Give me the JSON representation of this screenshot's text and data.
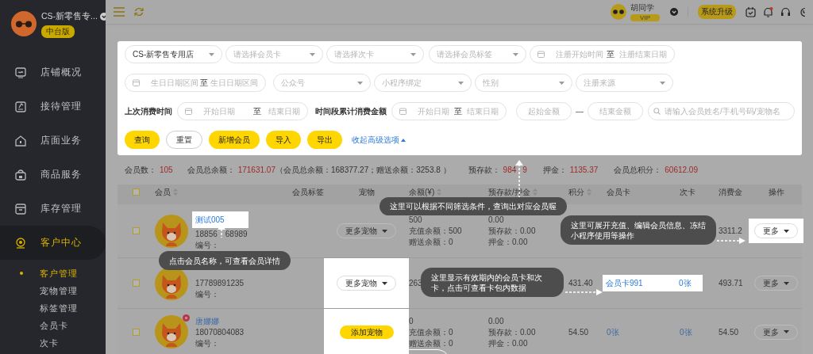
{
  "sidebar": {
    "store_name": "CS-新零售专...",
    "edition": "中台版",
    "menu": [
      {
        "label": "店铺概况",
        "selected": false
      },
      {
        "label": "接待管理",
        "selected": false
      },
      {
        "label": "店面业务",
        "selected": false
      },
      {
        "label": "商品服务",
        "selected": false
      },
      {
        "label": "库存管理",
        "selected": false
      },
      {
        "label": "客户中心",
        "selected": true
      }
    ],
    "submenu": [
      {
        "label": "客户管理",
        "selected": true
      },
      {
        "label": "宠物管理",
        "selected": false
      },
      {
        "label": "标签管理",
        "selected": false
      },
      {
        "label": "会员卡",
        "selected": false
      },
      {
        "label": "次卡",
        "selected": false
      }
    ]
  },
  "top_bar": {
    "user_name": "胡同学",
    "user_badge": "VIP",
    "upgrade_button": "系统升级",
    "unread_notifications": true
  },
  "filters": {
    "rows": [
      [
        {
          "kind": "select",
          "value": "CS-新零售专用店"
        },
        {
          "kind": "select",
          "placeholder": "请选择会员卡"
        },
        {
          "kind": "select",
          "placeholder": "请选择次卡"
        },
        {
          "kind": "select",
          "placeholder": "请选择会员标签"
        },
        {
          "kind": "daterange",
          "start_placeholder": "注册开始时间",
          "separator": "至",
          "end_placeholder": "注册结束日期"
        }
      ],
      [
        {
          "kind": "daterange",
          "start_placeholder": "生日日期区间",
          "separator": "至",
          "end_placeholder": "生日日期区间"
        },
        {
          "kind": "select",
          "placeholder": "公众号"
        },
        {
          "kind": "select",
          "placeholder": "小程序绑定"
        },
        {
          "kind": "select",
          "placeholder": "性别"
        },
        {
          "kind": "select",
          "placeholder": "注册来源"
        }
      ],
      [
        {
          "kind": "label",
          "text": "上次消费时间"
        },
        {
          "kind": "daterange",
          "start_placeholder": "开始日期",
          "separator": "至",
          "end_placeholder": "结束日期"
        },
        {
          "kind": "label",
          "text": "时间段累计消费金额"
        },
        {
          "kind": "daterange",
          "start_placeholder": "开始日期",
          "separator": "至",
          "end_placeholder": "结束日期"
        },
        {
          "kind": "input",
          "placeholder": "起始金额"
        },
        {
          "kind": "dash",
          "text": "—"
        },
        {
          "kind": "input",
          "placeholder": "结束金额"
        },
        {
          "kind": "search",
          "placeholder": "请输入会员姓名/手机号码/宠物名"
        }
      ]
    ],
    "buttons": [
      {
        "label": "查询",
        "kind": "primary"
      },
      {
        "label": "重置",
        "kind": "plain"
      },
      {
        "label": "新增会员",
        "kind": "primary"
      },
      {
        "label": "导入",
        "kind": "primary"
      },
      {
        "label": "导出",
        "kind": "primary"
      }
    ],
    "collapse_link": "收起高级选项"
  },
  "stats": [
    {
      "label": "会员数：",
      "value": "105"
    },
    {
      "label": "会员总余额：",
      "value": "171631.07",
      "note": "（会员总余额：168377.27；赠送余额：3253.8 ）"
    },
    {
      "label": "预存款：",
      "value": "984",
      "value_tail": "9"
    },
    {
      "label": "押金：",
      "value": "1135.37"
    },
    {
      "label": "会员总积分：",
      "value": "60612.09"
    }
  ],
  "table": {
    "select_all_checked": false,
    "columns": [
      {
        "label": "会员",
        "sortable": true
      },
      {
        "label": "会员标签",
        "sortable": false
      },
      {
        "label": "宠物",
        "sortable": false
      },
      {
        "label": "余额(¥)",
        "sortable": true
      },
      {
        "label": "预存款/押金",
        "sortable": true
      },
      {
        "label": "积分",
        "sortable": true
      },
      {
        "label": "会员卡",
        "sortable": false
      },
      {
        "label": "次卡",
        "sortable": false
      },
      {
        "label": "消费金",
        "sortable": false
      },
      {
        "label": "操作",
        "sortable": false
      }
    ],
    "rows": [
      {
        "checked": false,
        "avatar_badge": false,
        "name": "测试005",
        "phone": "18856",
        "phone_tail": "68989",
        "member_no": "编号：",
        "pets": {
          "kind": "more",
          "label": "更多宠物"
        },
        "balance": [
          "500",
          "充值余额：500",
          "赠送余额：0"
        ],
        "deposit": [
          "0.00",
          "预存款：0.00",
          "押金：0.00"
        ],
        "spending": "3311.2",
        "action": "更多",
        "name_spotlit": true,
        "pets_spotlit": false,
        "cards_spotlit": false,
        "action_spotlit": true
      },
      {
        "checked": false,
        "avatar_badge": false,
        "phone": "17789891235",
        "member_no": "编号：",
        "pets": {
          "kind": "more",
          "label": "更多宠物"
        },
        "balance": [
          "263"
        ],
        "points": "431.40",
        "member_card": "会员卡991",
        "count_card": "0张",
        "spending": "493.71",
        "action": "更多",
        "name_spotlit": false,
        "pets_spotlit": true,
        "cards_spotlit": true,
        "action_spotlit": false
      },
      {
        "checked": false,
        "avatar_badge": true,
        "name": "唐娜娜",
        "phone": "18070804083",
        "member_no": "编号：",
        "pets": {
          "kind": "add",
          "label": "添加宠物"
        },
        "balance": [
          "0",
          "充值余额：0",
          "赠送余额：0"
        ],
        "deposit": [
          "0.00",
          "预存款：0.00",
          "押金：0.00"
        ],
        "points": "54.50",
        "member_card": "0张",
        "count_card": "0张",
        "spending": "54.50",
        "action": "更多",
        "name_spotlit": false,
        "pets_spotlit": true,
        "cards_spotlit": false,
        "action_spotlit": false
      }
    ]
  },
  "tour_tips": [
    {
      "text": "这里可以根据不同筛选条件，查询出对应会员喔"
    },
    {
      "text": "点击会员名称，可查看会员详情"
    },
    {
      "text": "这里可展开充值、编辑会员信息、冻结小程序使用等操作"
    },
    {
      "text": "这里显示有效期内的会员卡和次卡，点击可查看卡包内数据"
    }
  ]
}
